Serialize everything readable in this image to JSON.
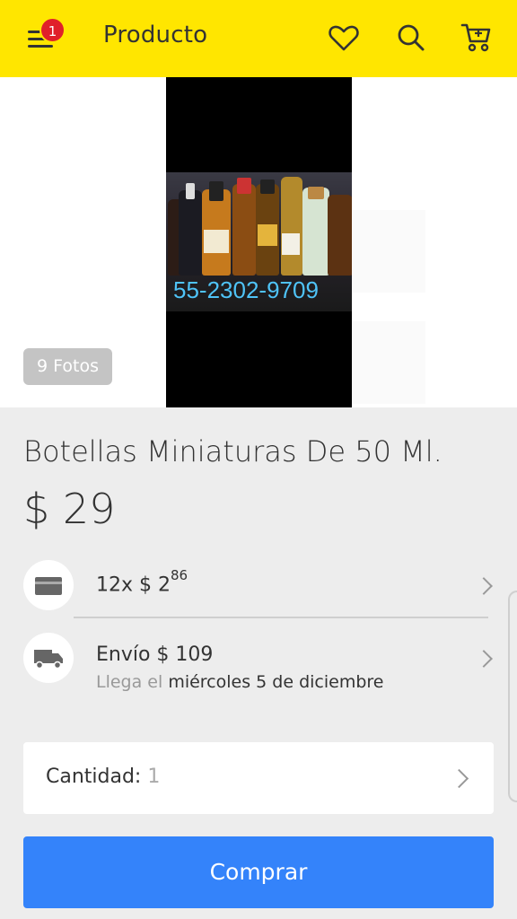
{
  "header": {
    "title": "Producto",
    "notification_count": "1",
    "icons": [
      "menu-icon",
      "heart-icon",
      "search-icon",
      "cart-icon"
    ]
  },
  "gallery": {
    "photo_overlay_text": "55-2302-9709",
    "photo_count_label": "9 Fotos"
  },
  "product": {
    "name": "Botellas Miniaturas De 50 Ml.",
    "price": "$ 29"
  },
  "installments": {
    "prefix": "12x $ 2",
    "cents": "86"
  },
  "shipping": {
    "label": "Envío $ 109",
    "arrival_prefix": "Llega el",
    "arrival_date": "miércoles 5 de diciembre"
  },
  "quantity": {
    "label": "Cantidad:",
    "value": "1"
  },
  "actions": {
    "buy_label": "Comprar"
  },
  "colors": {
    "header_bg": "#ffe600",
    "primary": "#3483fa",
    "badge": "#e0202a",
    "background": "#ededed"
  }
}
